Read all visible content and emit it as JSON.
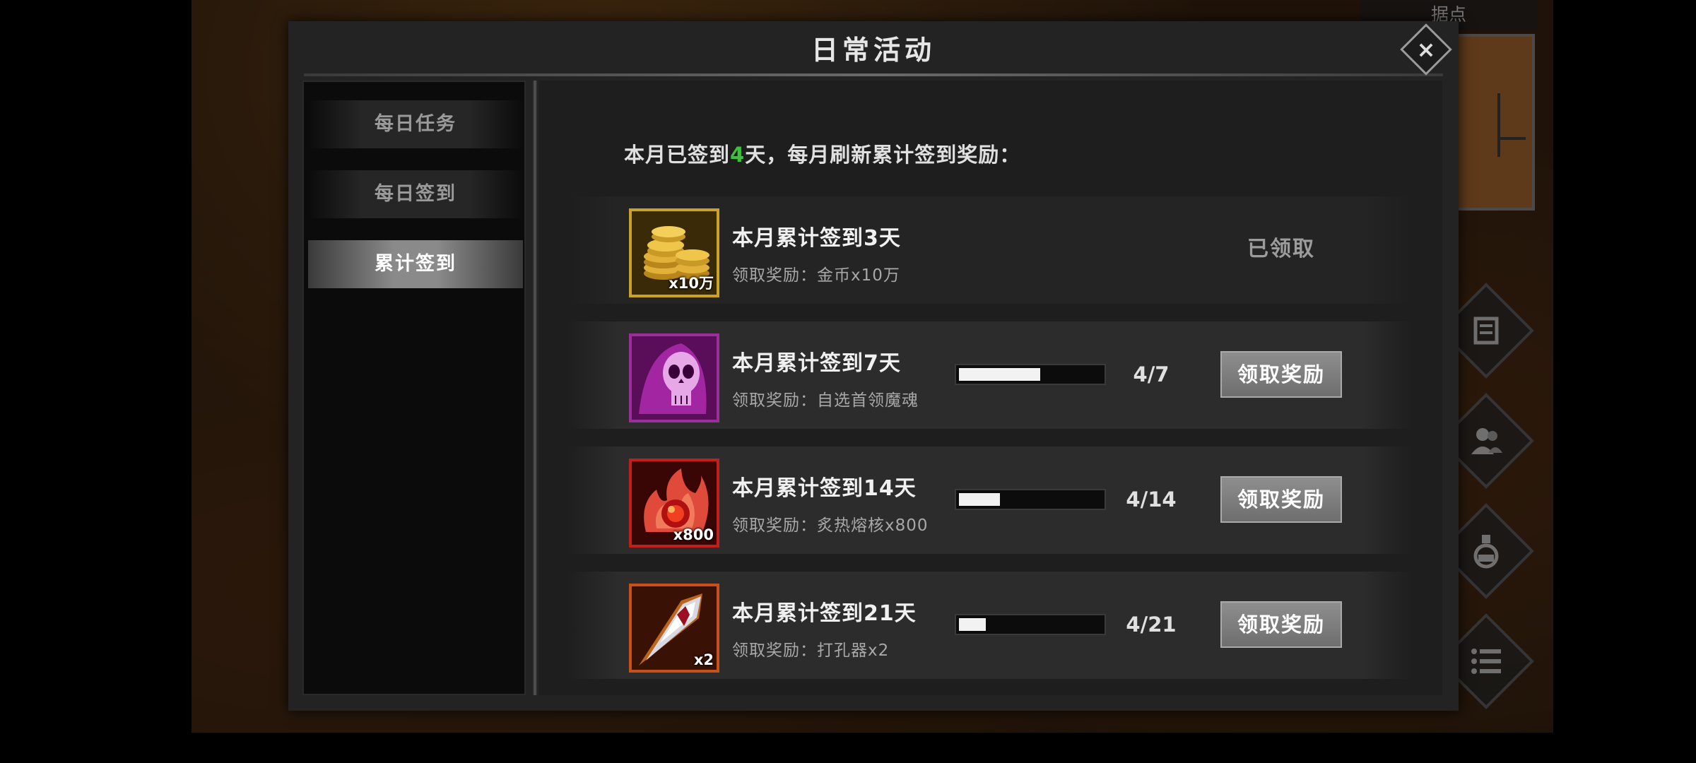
{
  "background": {
    "minimap_label": "据点"
  },
  "dialog": {
    "title": "日常活动",
    "close_glyph": "×",
    "tabs": [
      {
        "label": "每日任务",
        "active": false
      },
      {
        "label": "每日签到",
        "active": false
      },
      {
        "label": "累计签到",
        "active": true
      }
    ],
    "summary": {
      "prefix": "本月已签到",
      "days": "4",
      "suffix": "天，每月刷新累计签到奖励："
    },
    "rows": [
      {
        "title": "本月累计签到3天",
        "desc": "领取奖励：金币x10万",
        "qty": "x10万",
        "icon": "gold-coins-icon",
        "status": "已领取",
        "claimed": true
      },
      {
        "title": "本月累计签到7天",
        "desc": "领取奖励：自选首领魔魂",
        "qty": "",
        "icon": "boss-soul-skull-icon",
        "progress_text": "4/7",
        "progress": 0.571,
        "button": "领取奖励",
        "claimed": false
      },
      {
        "title": "本月累计签到14天",
        "desc": "领取奖励：炙热熔核x800",
        "qty": "x800",
        "icon": "molten-core-icon",
        "progress_text": "4/14",
        "progress": 0.286,
        "button": "领取奖励",
        "claimed": false
      },
      {
        "title": "本月累计签到21天",
        "desc": "领取奖励：打孔器x2",
        "qty": "x2",
        "icon": "punch-drill-icon",
        "progress_text": "4/21",
        "progress": 0.19,
        "button": "领取奖励",
        "claimed": false
      }
    ]
  },
  "colors": {
    "highlight_green": "#3ec23e",
    "gold_frame": "#c9a227",
    "purple_frame": "#9a2f9a",
    "red_frame": "#c0201a",
    "orange_frame": "#c8501a"
  }
}
